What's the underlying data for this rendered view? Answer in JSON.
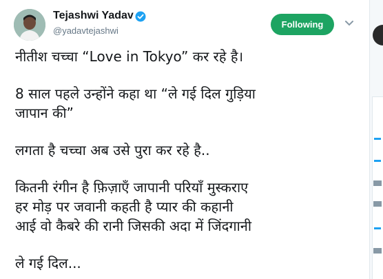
{
  "tweet": {
    "display_name": "Tejashwi Yadav",
    "handle": "@yadavtejashwi",
    "follow_button_label": "Following",
    "paragraphs": [
      "नीतीश चच्चा “Love in Tokyo” कर रहे है।",
      "8 साल पहले उन्होंने कहा था “ले गई दिल गुड़िया\nजापान की”",
      "लगता है चच्चा अब उसे पुरा कर रहे है..",
      "कितनी रंगीन है फ़िज़ाएँ जापानी परियाँ मुस्कराए\nहर मोड़ पर जवानी कहती है प्यार की कहानी\nआई वो कैबरे की रानी जिसकी अदा में जिंदगानी",
      "ले गई दिल..."
    ]
  },
  "colors": {
    "follow_bg": "#1da462",
    "verified": "#1da1f2",
    "handle_gray": "#657786",
    "text": "#14171a"
  },
  "icons": {
    "verified": "verified-badge-icon",
    "caret": "chevron-down-icon"
  }
}
